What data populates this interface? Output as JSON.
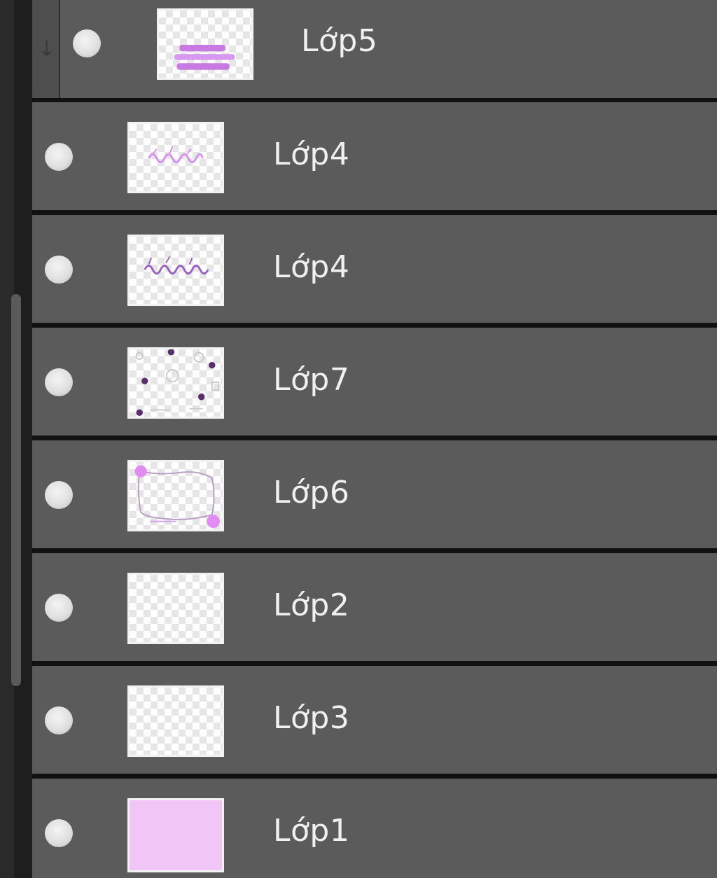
{
  "layers": [
    {
      "name": "Lớp5",
      "thumb": "stripes",
      "in_group": true
    },
    {
      "name": "Lớp4",
      "thumb": "text-pink"
    },
    {
      "name": "Lớp4",
      "thumb": "text-purple"
    },
    {
      "name": "Lớp7",
      "thumb": "dots"
    },
    {
      "name": "Lớp6",
      "thumb": "frame"
    },
    {
      "name": "Lớp2",
      "thumb": "empty"
    },
    {
      "name": "Lớp3",
      "thumb": "empty"
    },
    {
      "name": "Lớp1",
      "thumb": "solid",
      "fill": "#f1c6f7"
    }
  ],
  "colors": {
    "row_bg": "#5b5b5b",
    "separator": "#111111",
    "accent_purple": "#b56ad8"
  }
}
